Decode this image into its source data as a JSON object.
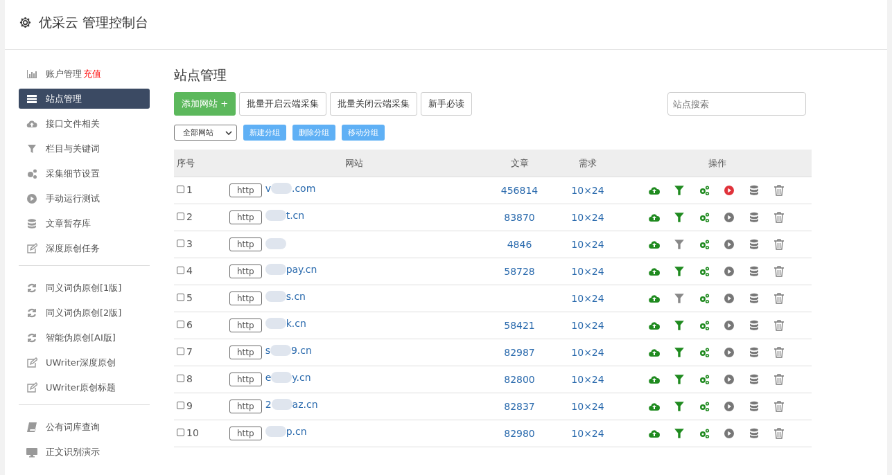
{
  "header": {
    "title": "优采云 管理控制台"
  },
  "sidebar": {
    "groups": [
      {
        "items": [
          {
            "kind": "chart",
            "label": "账户管理",
            "badge": "充值",
            "selected": false
          },
          {
            "kind": "list",
            "label": "站点管理",
            "selected": true
          },
          {
            "kind": "cloud",
            "label": "接口文件相关",
            "selected": false
          },
          {
            "kind": "filter",
            "label": "栏目与关键词",
            "selected": false
          },
          {
            "kind": "gears",
            "label": "采集细节设置",
            "selected": false
          },
          {
            "kind": "play",
            "label": "手动运行测试",
            "selected": false
          },
          {
            "kind": "db",
            "label": "文章暂存库",
            "selected": false
          },
          {
            "kind": "edit",
            "label": "深度原创任务",
            "selected": false
          }
        ]
      },
      {
        "items": [
          {
            "kind": "refresh",
            "label": "同义词伪原创[1版]",
            "selected": false
          },
          {
            "kind": "refresh",
            "label": "同义词伪原创[2版]",
            "selected": false
          },
          {
            "kind": "refresh",
            "label": "智能伪原创[AI版]",
            "selected": false
          },
          {
            "kind": "edit",
            "label": "UWriter深度原创",
            "selected": false
          },
          {
            "kind": "edit",
            "label": "UWriter原创标题",
            "selected": false
          }
        ]
      },
      {
        "items": [
          {
            "kind": "book",
            "label": "公有词库查询",
            "selected": false
          },
          {
            "kind": "monitor",
            "label": "正文识别演示",
            "selected": false
          }
        ]
      }
    ]
  },
  "main": {
    "title": "站点管理",
    "buttons": [
      {
        "kind": "primary",
        "label": "添加网站 +"
      },
      {
        "kind": "default",
        "label": "批量开启云端采集"
      },
      {
        "kind": "default",
        "label": "批量关闭云端采集"
      },
      {
        "kind": "default",
        "label": "新手必读"
      }
    ],
    "search": {
      "placeholder": "站点搜索"
    },
    "group_select": {
      "value": "全部网站"
    },
    "group_buttons": [
      "新建分组",
      "删除分组",
      "移动分组"
    ],
    "table": {
      "columns": [
        "序号",
        "网站",
        "文章",
        "需求",
        "操作"
      ],
      "rows": [
        {
          "checked": false,
          "index": "1",
          "tag": "http",
          "url_start": "v",
          "url_end": ".com",
          "articles": "456814",
          "demand": "10×24",
          "filter_on": true,
          "running": true
        },
        {
          "checked": false,
          "index": "2",
          "tag": "http",
          "url_end": "t.cn",
          "articles": "83870",
          "demand": "10×24",
          "filter_on": true,
          "running": false
        },
        {
          "checked": false,
          "index": "3",
          "tag": "http",
          "articles": "4846",
          "demand": "10×24",
          "filter_on": false,
          "running": false
        },
        {
          "checked": false,
          "index": "4",
          "tag": "http",
          "url_end": "pay.cn",
          "articles": "58728",
          "demand": "10×24",
          "filter_on": true,
          "running": false
        },
        {
          "checked": false,
          "index": "5",
          "tag": "http",
          "url_end": "s.cn",
          "demand": "10×24",
          "filter_on": false,
          "running": false
        },
        {
          "checked": false,
          "index": "6",
          "tag": "http",
          "url_end": "k.cn",
          "articles": "58421",
          "demand": "10×24",
          "filter_on": true,
          "running": false
        },
        {
          "checked": false,
          "index": "7",
          "tag": "http",
          "url_start": "s",
          "url_end": "9.cn",
          "articles": "82987",
          "demand": "10×24",
          "filter_on": true,
          "running": false
        },
        {
          "checked": false,
          "index": "8",
          "tag": "http",
          "url_start": "e",
          "url_end": "y.cn",
          "articles": "82800",
          "demand": "10×24",
          "filter_on": true,
          "running": false
        },
        {
          "checked": false,
          "index": "9",
          "tag": "http",
          "url_start": "2",
          "url_end": "az.cn",
          "articles": "82837",
          "demand": "10×24",
          "filter_on": true,
          "running": false
        },
        {
          "checked": false,
          "index": "10",
          "tag": "http",
          "url_end": "p.cn",
          "articles": "82980",
          "demand": "10×24",
          "filter_on": true,
          "running": false
        }
      ]
    }
  }
}
